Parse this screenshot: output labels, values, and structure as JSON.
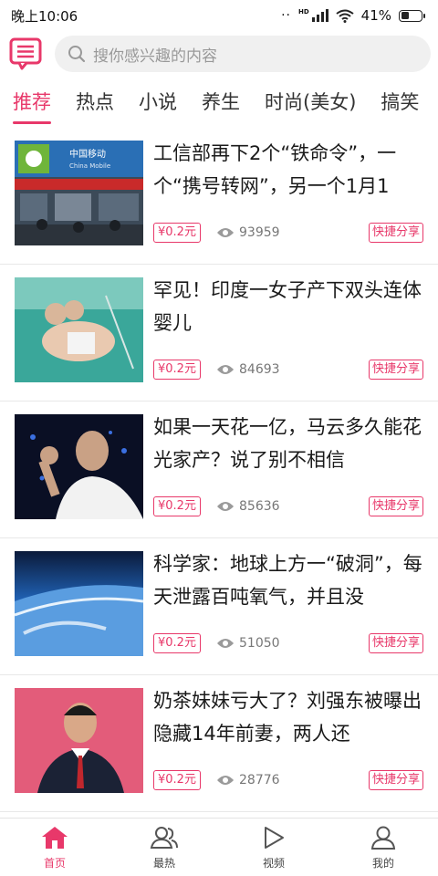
{
  "status_bar": {
    "time": "晚上10:06",
    "network": "HD",
    "battery": "41%",
    "battery_level": 0.41
  },
  "header": {
    "message_icon": "message-icon",
    "search": {
      "placeholder": "搜你感兴趣的内容",
      "icon": "search-icon"
    }
  },
  "tabs": [
    {
      "label": "推荐",
      "active": true
    },
    {
      "label": "热点"
    },
    {
      "label": "小说"
    },
    {
      "label": "养生"
    },
    {
      "label": "时尚(美女)"
    },
    {
      "label": "搞笑"
    }
  ],
  "news": [
    {
      "title": "工信部再下2个“铁命令”，一个“携号转网”，另一个1月1",
      "reward": "¥0.2元",
      "views": "93959",
      "share": "快捷分享"
    },
    {
      "title": "罕见！印度一女子产下双头连体婴儿",
      "reward": "¥0.2元",
      "views": "84693",
      "share": "快捷分享"
    },
    {
      "title": "如果一天花一亿，马云多久能花光家产？说了别不相信",
      "reward": "¥0.2元",
      "views": "85636",
      "share": "快捷分享"
    },
    {
      "title": "科学家：地球上方一“破洞”，每天泄露百吨氧气，并且没",
      "reward": "¥0.2元",
      "views": "51050",
      "share": "快捷分享"
    },
    {
      "title": "奶茶妹妹亏大了？刘强东被曝出隐藏14年前妻，两人还",
      "reward": "¥0.2元",
      "views": "28776",
      "share": "快捷分享"
    }
  ],
  "bottom_nav": [
    {
      "label": "首页",
      "icon": "home-icon",
      "active": true
    },
    {
      "label": "最热",
      "icon": "users-icon"
    },
    {
      "label": "视频",
      "icon": "play-icon"
    },
    {
      "label": "我的",
      "icon": "user-icon"
    }
  ],
  "colors": {
    "accent": "#e8386a",
    "muted": "#999999",
    "divider": "#e8e8e8"
  }
}
